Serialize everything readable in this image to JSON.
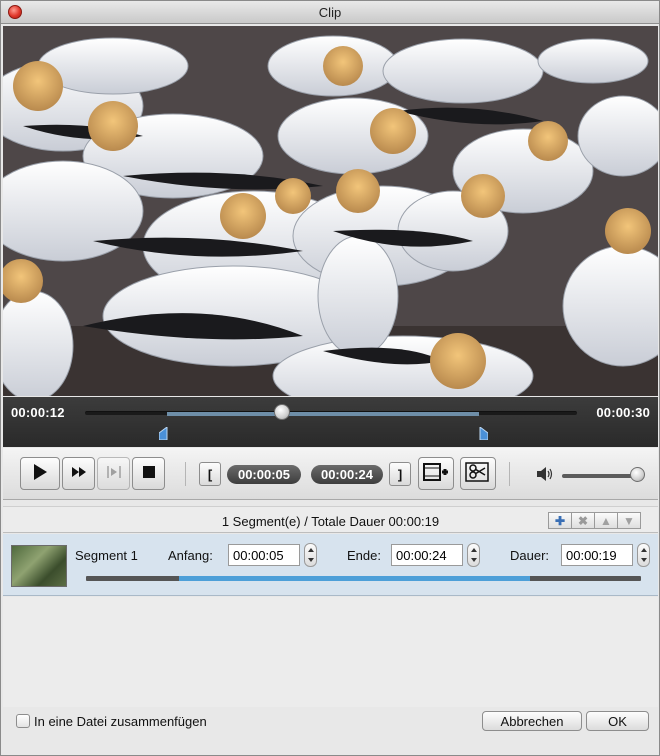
{
  "window": {
    "title": "Clip"
  },
  "player": {
    "current_time": "00:00:12",
    "total_time": "00:00:30",
    "position_fraction": 0.4,
    "selection_start_fraction": 0.1667,
    "selection_end_fraction": 0.8,
    "start_time": "00:00:05",
    "end_time": "00:00:24",
    "volume_fraction": 1.0
  },
  "segments_header": {
    "summary": "1 Segment(e) / Totale Dauer 00:00:19"
  },
  "segments": [
    {
      "name": "Segment 1",
      "start_label": "Anfang:",
      "start": "00:00:05",
      "end_label": "Ende:",
      "end": "00:00:24",
      "duration_label": "Dauer:",
      "duration": "00:00:19"
    }
  ],
  "footer": {
    "merge_label": "In eine Datei zusammenfügen",
    "merge_checked": false,
    "cancel_label": "Abbrechen",
    "ok_label": "OK"
  },
  "icons": {
    "play": "play-icon",
    "fast_forward": "fast-forward-icon",
    "frame_step": "frame-step-icon",
    "stop": "stop-icon",
    "add_clip": "add-clip-icon",
    "cut_clip": "scissors-icon",
    "volume": "volume-icon"
  },
  "colors": {
    "selection_blue": "#4d9fd8",
    "segment_row": "#d7e3ee",
    "close_red": "#e0372b"
  }
}
